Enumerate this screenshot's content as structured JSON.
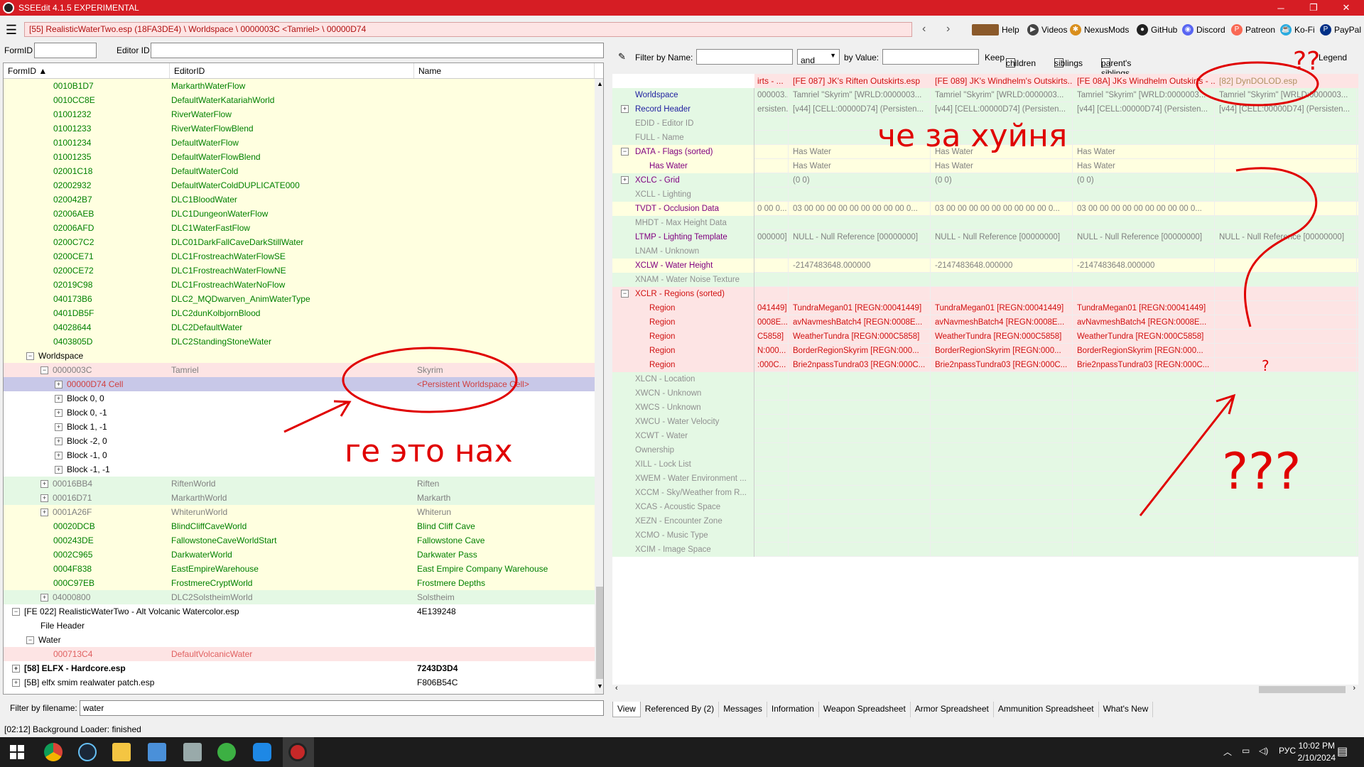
{
  "window": {
    "title": "SSEEdit 4.1.5 EXPERIMENTAL",
    "minimize": "─",
    "maximize": "❐",
    "close": "✕"
  },
  "path": "[55] RealisticWaterTwo.esp (18FA3DE4) \\ Worldspace \\ 0000003C <Tamriel> \\ 00000D74",
  "toplinks": [
    "Help",
    "Videos",
    "NexusMods",
    "GitHub",
    "Discord",
    "Patreon",
    "Ko-Fi",
    "PayPal"
  ],
  "left_filters": {
    "formid_label": "FormID",
    "editorid_label": "Editor ID"
  },
  "tree_headers": [
    "FormID",
    "EditorID",
    "Name"
  ],
  "tree_rows": [
    {
      "c1": "0010B1D7",
      "c2": "MarkarthWaterFlow",
      "c3": "",
      "indent": 70,
      "bg": "y",
      "cls": "green"
    },
    {
      "c1": "0010CC8E",
      "c2": "DefaultWaterKatariahWorld",
      "c3": "",
      "indent": 70,
      "bg": "y",
      "cls": "green"
    },
    {
      "c1": "01001232",
      "c2": "RiverWaterFlow",
      "c3": "",
      "indent": 70,
      "bg": "y",
      "cls": "green"
    },
    {
      "c1": "01001233",
      "c2": "RiverWaterFlowBlend",
      "c3": "",
      "indent": 70,
      "bg": "y",
      "cls": "green"
    },
    {
      "c1": "01001234",
      "c2": "DefaultWaterFlow",
      "c3": "",
      "indent": 70,
      "bg": "y",
      "cls": "green"
    },
    {
      "c1": "01001235",
      "c2": "DefaultWaterFlowBlend",
      "c3": "",
      "indent": 70,
      "bg": "y",
      "cls": "green"
    },
    {
      "c1": "02001C18",
      "c2": "DefaultWaterCold",
      "c3": "",
      "indent": 70,
      "bg": "y",
      "cls": "green"
    },
    {
      "c1": "02002932",
      "c2": "DefaultWaterColdDUPLICATE000",
      "c3": "",
      "indent": 70,
      "bg": "y",
      "cls": "green"
    },
    {
      "c1": "020042B7",
      "c2": "DLC1BloodWater",
      "c3": "",
      "indent": 70,
      "bg": "y",
      "cls": "green"
    },
    {
      "c1": "02006AEB",
      "c2": "DLC1DungeonWaterFlow",
      "c3": "",
      "indent": 70,
      "bg": "y",
      "cls": "green"
    },
    {
      "c1": "02006AFD",
      "c2": "DLC1WaterFastFlow",
      "c3": "",
      "indent": 70,
      "bg": "y",
      "cls": "green"
    },
    {
      "c1": "0200C7C2",
      "c2": "DLC01DarkFallCaveDarkStillWater",
      "c3": "",
      "indent": 70,
      "bg": "y",
      "cls": "green"
    },
    {
      "c1": "0200CE71",
      "c2": "DLC1FrostreachWaterFlowSE",
      "c3": "",
      "indent": 70,
      "bg": "y",
      "cls": "green"
    },
    {
      "c1": "0200CE72",
      "c2": "DLC1FrostreachWaterFlowNE",
      "c3": "",
      "indent": 70,
      "bg": "y",
      "cls": "green"
    },
    {
      "c1": "02019C98",
      "c2": "DLC1FrostreachWaterNoFlow",
      "c3": "",
      "indent": 70,
      "bg": "y",
      "cls": "green"
    },
    {
      "c1": "040173B6",
      "c2": "DLC2_MQDwarven_AnimWaterType",
      "c3": "",
      "indent": 70,
      "bg": "y",
      "cls": "green"
    },
    {
      "c1": "0401DB5F",
      "c2": "DLC2dunKolbjornBlood",
      "c3": "",
      "indent": 70,
      "bg": "y",
      "cls": "green"
    },
    {
      "c1": "04028644",
      "c2": "DLC2DefaultWater",
      "c3": "",
      "indent": 70,
      "bg": "y",
      "cls": "green"
    },
    {
      "c1": "0403805D",
      "c2": "DLC2StandingStoneWater",
      "c3": "",
      "indent": 70,
      "bg": "y",
      "cls": "green"
    },
    {
      "c1": "Worldspace",
      "c2": "",
      "c3": "",
      "indent": 32,
      "bg": "y",
      "cls": "",
      "exp": "−"
    },
    {
      "c1": "0000003C",
      "c2": "Tamriel",
      "c3": "Skyrim",
      "indent": 52,
      "bg": "pk",
      "cls": "gray",
      "exp": "−"
    },
    {
      "c1": "00000D74  Cell",
      "c2": "",
      "c3": "<Persistent Worldspace Cell>",
      "indent": 72,
      "bg": "sel",
      "cls": "red",
      "exp": "+"
    },
    {
      "c1": "Block 0, 0",
      "c2": "",
      "c3": "",
      "indent": 72,
      "bg": "wh",
      "cls": "",
      "exp": "+"
    },
    {
      "c1": "Block 0, -1",
      "c2": "",
      "c3": "",
      "indent": 72,
      "bg": "wh",
      "cls": "",
      "exp": "+"
    },
    {
      "c1": "Block 1, -1",
      "c2": "",
      "c3": "",
      "indent": 72,
      "bg": "wh",
      "cls": "",
      "exp": "+"
    },
    {
      "c1": "Block -2, 0",
      "c2": "",
      "c3": "",
      "indent": 72,
      "bg": "wh",
      "cls": "",
      "exp": "+"
    },
    {
      "c1": "Block -1, 0",
      "c2": "",
      "c3": "",
      "indent": 72,
      "bg": "wh",
      "cls": "",
      "exp": "+"
    },
    {
      "c1": "Block -1, -1",
      "c2": "",
      "c3": "",
      "indent": 72,
      "bg": "wh",
      "cls": "",
      "exp": "+"
    },
    {
      "c1": "00016BB4",
      "c2": "RiftenWorld",
      "c3": "Riften",
      "indent": 52,
      "bg": "gr",
      "cls": "gray",
      "exp": "+"
    },
    {
      "c1": "00016D71",
      "c2": "MarkarthWorld",
      "c3": "Markarth",
      "indent": 52,
      "bg": "gr",
      "cls": "gray",
      "exp": "+"
    },
    {
      "c1": "0001A26F",
      "c2": "WhiterunWorld",
      "c3": "Whiterun",
      "indent": 52,
      "bg": "y",
      "cls": "gray",
      "exp": "+"
    },
    {
      "c1": "00020DCB",
      "c2": "BlindCliffCaveWorld",
      "c3": "Blind Cliff Cave",
      "indent": 70,
      "bg": "y",
      "cls": "green"
    },
    {
      "c1": "000243DE",
      "c2": "FallowstoneCaveWorldStart",
      "c3": "Fallowstone Cave",
      "indent": 70,
      "bg": "y",
      "cls": "green"
    },
    {
      "c1": "0002C965",
      "c2": "DarkwaterWorld",
      "c3": "Darkwater Pass",
      "indent": 70,
      "bg": "y",
      "cls": "green"
    },
    {
      "c1": "0004F838",
      "c2": "EastEmpireWarehouse",
      "c3": "East Empire Company Warehouse",
      "indent": 70,
      "bg": "y",
      "cls": "green"
    },
    {
      "c1": "000C97EB",
      "c2": "FrostmereCryptWorld",
      "c3": "Frostmere Depths",
      "indent": 70,
      "bg": "y",
      "cls": "green"
    },
    {
      "c1": "04000800",
      "c2": "DLC2SolstheimWorld",
      "c3": "Solstheim",
      "indent": 52,
      "bg": "gr",
      "cls": "gray",
      "exp": "+"
    },
    {
      "c1": "[FE 022] RealisticWaterTwo - Alt Volcanic Watercolor.esp",
      "c2": "",
      "c3": "4E139248",
      "indent": 12,
      "bg": "wh",
      "cls": "",
      "exp": "−"
    },
    {
      "c1": "File Header",
      "c2": "",
      "c3": "",
      "indent": 52,
      "bg": "wh",
      "cls": ""
    },
    {
      "c1": "Water",
      "c2": "",
      "c3": "",
      "indent": 32,
      "bg": "wh",
      "cls": "",
      "exp": "−"
    },
    {
      "c1": "000713C4",
      "c2": "DefaultVolcanicWater",
      "c3": "",
      "indent": 70,
      "bg": "pk",
      "cls": "pink"
    },
    {
      "c1": "[58] ELFX - Hardcore.esp",
      "c2": "",
      "c3": "7243D3D4",
      "indent": 12,
      "bg": "wh",
      "cls": "bold",
      "exp": "+"
    },
    {
      "c1": "[5B] elfx smim realwater patch.esp",
      "c2": "",
      "c3": "F806B54C",
      "indent": 12,
      "bg": "wh",
      "cls": "",
      "exp": "+"
    }
  ],
  "filename_filter": {
    "label": "Filter by filename:",
    "value": "water"
  },
  "status": "[02:12] Background Loader: finished",
  "right_filters": {
    "name_label": "Filter by Name:",
    "op": "and",
    "value_label": "by Value:",
    "keep_label": "Keep",
    "children": "children",
    "siblings": "siblings",
    "parents_siblings": "parent's siblings",
    "legend": "Legend"
  },
  "grid_headers": [
    "irts - ...",
    "[FE 087] JK's Riften Outskirts.esp",
    "[FE 089] JK's Windhelm's Outskirts...",
    "[FE 08A] JKs Windhelm Outskirts - ...",
    "[82] DynDOLOD.esp"
  ],
  "grid_rows": [
    {
      "label": "Worldspace",
      "bg": "gr",
      "lc": "#2020a0",
      "cells": [
        "000003...",
        "Tamriel \"Skyrim\" [WRLD:0000003...",
        "Tamriel \"Skyrim\" [WRLD:0000003...",
        "Tamriel \"Skyrim\" [WRLD:0000003...",
        "Tamriel \"Skyrim\" [WRLD:0000003..."
      ],
      "cc": "#808080"
    },
    {
      "label": "Record Header",
      "bg": "gr",
      "lc": "#2020a0",
      "exp": "+",
      "cells": [
        "ersisten...",
        "[v44] [CELL:00000D74] (Persisten...",
        "[v44] [CELL:00000D74] (Persisten...",
        "[v44] [CELL:00000D74] (Persisten...",
        "[v44] [CELL:00000D74] (Persisten..."
      ],
      "cc": "#808080"
    },
    {
      "label": "EDID - Editor ID",
      "bg": "gr",
      "lc": "#909090",
      "cells": [
        "",
        "",
        "",
        "",
        ""
      ],
      "cc": "#808080"
    },
    {
      "label": "FULL - Name",
      "bg": "gr",
      "lc": "#909090",
      "cells": [
        "",
        "",
        "",
        "",
        ""
      ],
      "cc": "#808080"
    },
    {
      "label": "DATA - Flags (sorted)",
      "bg": "y",
      "lc": "#800080",
      "exp": "−",
      "cells": [
        "",
        "Has Water",
        "Has Water",
        "Has Water",
        ""
      ],
      "cc": "#808080"
    },
    {
      "label": "Has Water",
      "bg": "y",
      "lc": "#800080",
      "indent": true,
      "cells": [
        "",
        "Has Water",
        "Has Water",
        "Has Water",
        ""
      ],
      "cc": "#808080"
    },
    {
      "label": "XCLC - Grid",
      "bg": "gr",
      "lc": "#800080",
      "exp": "+",
      "cells": [
        "",
        "(0 0)",
        "(0 0)",
        "(0 0)",
        ""
      ],
      "cc": "#808080"
    },
    {
      "label": "XCLL - Lighting",
      "bg": "gr",
      "lc": "#909090",
      "cells": [
        "",
        "",
        "",
        "",
        ""
      ],
      "cc": "#808080"
    },
    {
      "label": "TVDT - Occlusion Data",
      "bg": "y",
      "lc": "#800080",
      "cells": [
        "0 00 0...",
        "03 00 00 00 00 00 00 00 00 00 0...",
        "03 00 00 00 00 00 00 00 00 00 0...",
        "03 00 00 00 00 00 00 00 00 00 0...",
        ""
      ],
      "cc": "#808080"
    },
    {
      "label": "MHDT - Max Height Data",
      "bg": "gr",
      "lc": "#909090",
      "cells": [
        "",
        "",
        "",
        "",
        ""
      ],
      "cc": "#808080"
    },
    {
      "label": "LTMP - Lighting Template",
      "bg": "gr",
      "lc": "#800080",
      "cells": [
        "000000]",
        "NULL - Null Reference [00000000]",
        "NULL - Null Reference [00000000]",
        "NULL - Null Reference [00000000]",
        "NULL - Null Reference [00000000]"
      ],
      "cc": "#808080"
    },
    {
      "label": "LNAM - Unknown",
      "bg": "gr",
      "lc": "#909090",
      "cells": [
        "",
        "",
        "",
        "",
        ""
      ],
      "cc": "#808080"
    },
    {
      "label": "XCLW - Water Height",
      "bg": "y",
      "lc": "#800080",
      "cells": [
        "",
        "-2147483648.000000",
        "-2147483648.000000",
        "-2147483648.000000",
        ""
      ],
      "cc": "#808080"
    },
    {
      "label": "XNAM - Water Noise Texture",
      "bg": "gr",
      "lc": "#909090",
      "cells": [
        "",
        "",
        "",
        "",
        ""
      ],
      "cc": "#808080"
    },
    {
      "label": "XCLR - Regions (sorted)",
      "bg": "pk",
      "lc": "#d01010",
      "exp": "−",
      "cells": [
        "",
        "",
        "",
        "",
        ""
      ],
      "cc": "#d01010"
    },
    {
      "label": "Region",
      "bg": "pk",
      "lc": "#d01010",
      "indent": true,
      "cells": [
        "041449]",
        "TundraMegan01 [REGN:00041449]",
        "TundraMegan01 [REGN:00041449]",
        "TundraMegan01 [REGN:00041449]",
        ""
      ],
      "cc": "#d01010"
    },
    {
      "label": "Region",
      "bg": "pk",
      "lc": "#d01010",
      "indent": true,
      "cells": [
        "0008E...",
        "avNavmeshBatch4 [REGN:0008E...",
        "avNavmeshBatch4 [REGN:0008E...",
        "avNavmeshBatch4 [REGN:0008E...",
        ""
      ],
      "cc": "#d01010"
    },
    {
      "label": "Region",
      "bg": "pk",
      "lc": "#d01010",
      "indent": true,
      "cells": [
        "C5858]",
        "WeatherTundra [REGN:000C5858]",
        "WeatherTundra [REGN:000C5858]",
        "WeatherTundra [REGN:000C5858]",
        ""
      ],
      "cc": "#d01010"
    },
    {
      "label": "Region",
      "bg": "pk",
      "lc": "#d01010",
      "indent": true,
      "cells": [
        "N:000...",
        "BorderRegionSkyrim [REGN:000...",
        "BorderRegionSkyrim [REGN:000...",
        "BorderRegionSkyrim [REGN:000...",
        ""
      ],
      "cc": "#d01010"
    },
    {
      "label": "Region",
      "bg": "pk",
      "lc": "#d01010",
      "indent": true,
      "cells": [
        ":000C...",
        "Brie2npassTundra03 [REGN:000C...",
        "Brie2npassTundra03 [REGN:000C...",
        "Brie2npassTundra03 [REGN:000C...",
        ""
      ],
      "cc": "#d01010"
    },
    {
      "label": "XLCN - Location",
      "bg": "gr",
      "lc": "#909090",
      "cells": [
        "",
        "",
        "",
        "",
        ""
      ],
      "cc": "#808080"
    },
    {
      "label": "XWCN - Unknown",
      "bg": "gr",
      "lc": "#909090",
      "cells": [
        "",
        "",
        "",
        "",
        ""
      ],
      "cc": "#808080"
    },
    {
      "label": "XWCS - Unknown",
      "bg": "gr",
      "lc": "#909090",
      "cells": [
        "",
        "",
        "",
        "",
        ""
      ],
      "cc": "#808080"
    },
    {
      "label": "XWCU - Water Velocity",
      "bg": "gr",
      "lc": "#909090",
      "cells": [
        "",
        "",
        "",
        "",
        ""
      ],
      "cc": "#808080"
    },
    {
      "label": "XCWT - Water",
      "bg": "gr",
      "lc": "#909090",
      "cells": [
        "",
        "",
        "",
        "",
        ""
      ],
      "cc": "#808080"
    },
    {
      "label": "Ownership",
      "bg": "gr",
      "lc": "#909090",
      "cells": [
        "",
        "",
        "",
        "",
        ""
      ],
      "cc": "#808080"
    },
    {
      "label": "XILL - Lock List",
      "bg": "gr",
      "lc": "#909090",
      "cells": [
        "",
        "",
        "",
        "",
        ""
      ],
      "cc": "#808080"
    },
    {
      "label": "XWEM - Water Environment ...",
      "bg": "gr",
      "lc": "#909090",
      "cells": [
        "",
        "",
        "",
        "",
        ""
      ],
      "cc": "#808080"
    },
    {
      "label": "XCCM - Sky/Weather from R...",
      "bg": "gr",
      "lc": "#909090",
      "cells": [
        "",
        "",
        "",
        "",
        ""
      ],
      "cc": "#808080"
    },
    {
      "label": "XCAS - Acoustic Space",
      "bg": "gr",
      "lc": "#909090",
      "cells": [
        "",
        "",
        "",
        "",
        ""
      ],
      "cc": "#808080"
    },
    {
      "label": "XEZN - Encounter Zone",
      "bg": "gr",
      "lc": "#909090",
      "cells": [
        "",
        "",
        "",
        "",
        ""
      ],
      "cc": "#808080"
    },
    {
      "label": "XCMO - Music Type",
      "bg": "gr",
      "lc": "#909090",
      "cells": [
        "",
        "",
        "",
        "",
        ""
      ],
      "cc": "#808080"
    },
    {
      "label": "XCIM - Image Space",
      "bg": "gr",
      "lc": "#909090",
      "cells": [
        "",
        "",
        "",
        "",
        ""
      ],
      "cc": "#808080"
    }
  ],
  "bottom_tabs": [
    "View",
    "Referenced By (2)",
    "Messages",
    "Information",
    "Weapon Spreadsheet",
    "Armor Spreadsheet",
    "Ammunition Spreadsheet",
    "What's New"
  ],
  "tray": {
    "lang": "РУС",
    "time": "10:02 PM",
    "date": "2/10/2024"
  },
  "annotations": {
    "left": "ге это нах",
    "top": "че за хуйня",
    "q1": "??",
    "q2": "?",
    "q3": "???"
  },
  "colors": {
    "titlebar": "#d61d24",
    "annotation": "#e00000"
  }
}
